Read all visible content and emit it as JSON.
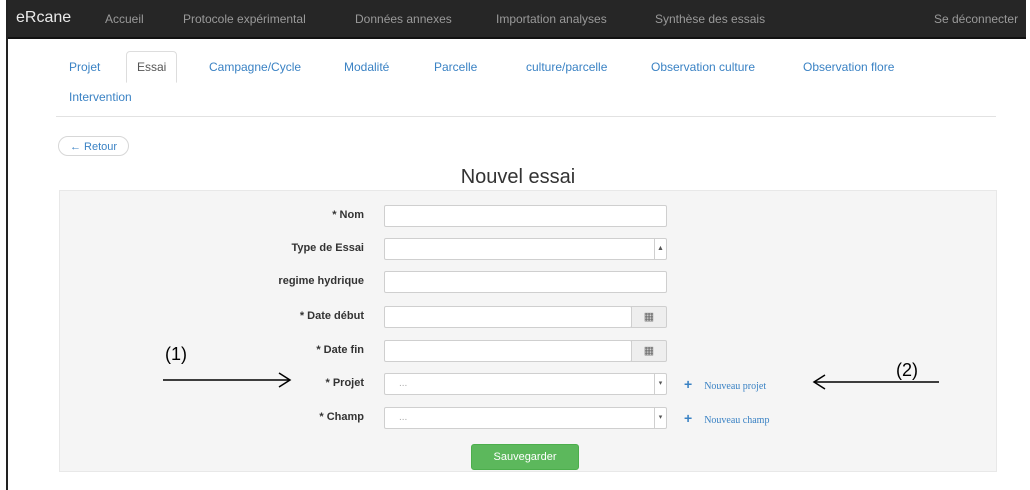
{
  "navbar": {
    "brand": "eRcane",
    "links": [
      "Accueil",
      "Protocole expérimental",
      "Données annexes",
      "Importation analyses",
      "Synthèse des essais"
    ],
    "logout": "Se déconnecter"
  },
  "subtabs": [
    "Projet",
    "Essai",
    "Campagne/Cycle",
    "Modalité",
    "Parcelle",
    "culture/parcelle",
    "Observation culture",
    "Observation flore",
    "Intervention"
  ],
  "active_tab": "Essai",
  "back_label": "← Retour",
  "page_title": "Nouvel essai",
  "form": {
    "fields": [
      {
        "label": "* Nom",
        "type": "text",
        "value": ""
      },
      {
        "label": "Type de Essai",
        "type": "select",
        "value": ""
      },
      {
        "label": "regime hydrique",
        "type": "text",
        "value": ""
      },
      {
        "label": "* Date début",
        "type": "date",
        "value": ""
      },
      {
        "label": "* Date fin",
        "type": "date",
        "value": ""
      },
      {
        "label": "* Projet",
        "type": "select",
        "value": "..."
      },
      {
        "label": "* Champ",
        "type": "select",
        "value": "..."
      }
    ],
    "new_projet": "Nouveau projet",
    "new_champ": "Nouveau champ",
    "save_label": "Sauvegarder"
  },
  "annotations": {
    "left": "(1)",
    "right": "(2)"
  }
}
